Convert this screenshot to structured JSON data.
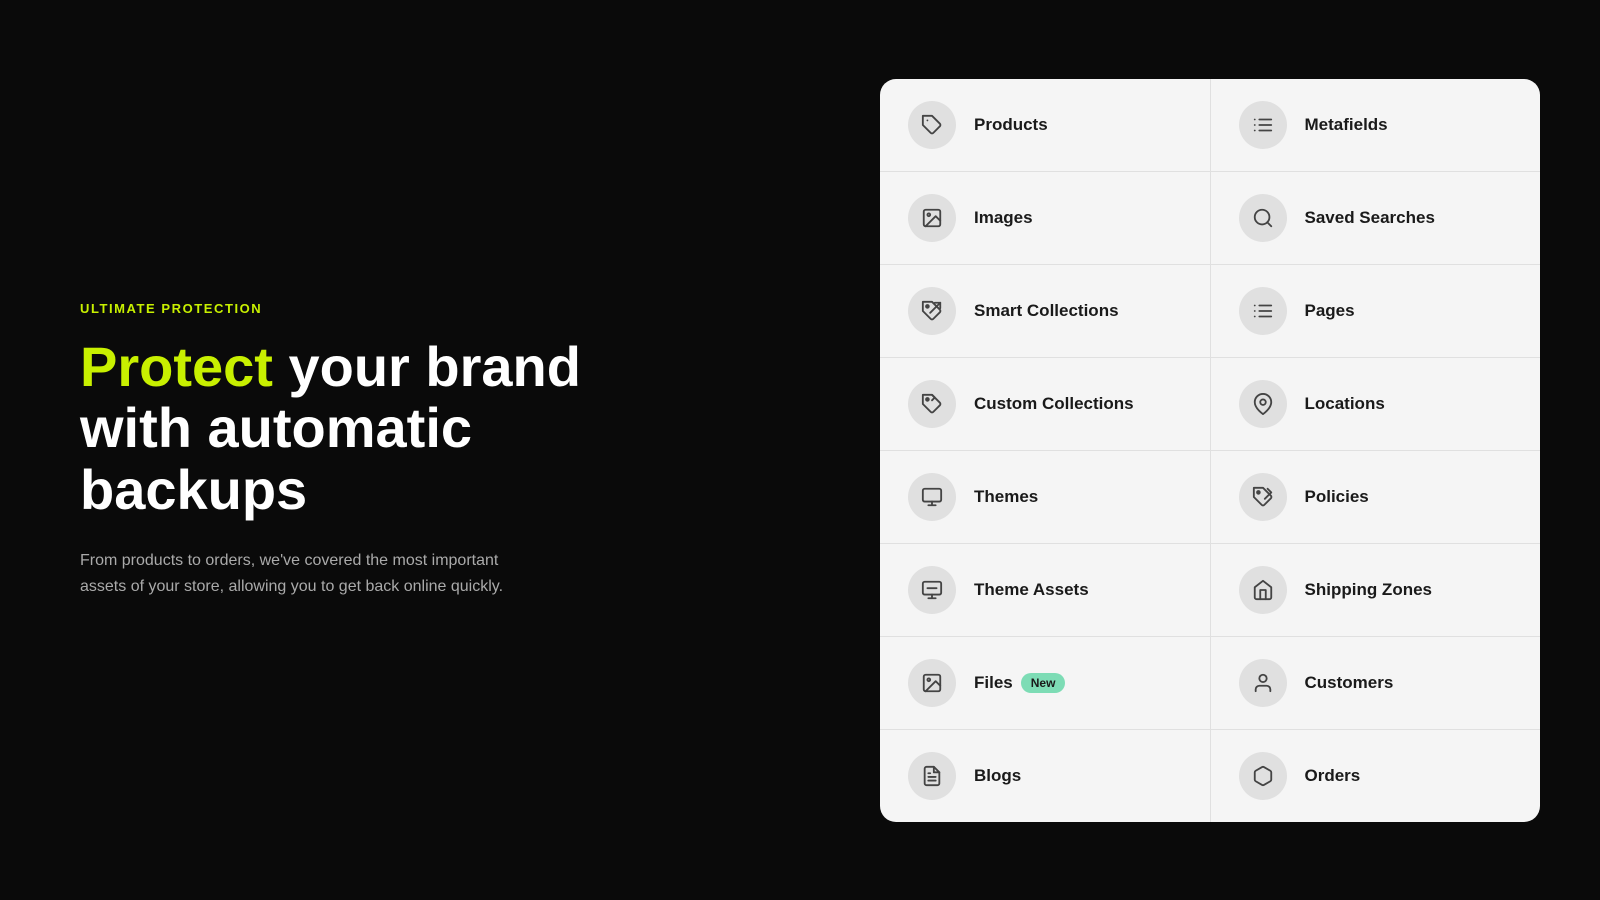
{
  "left": {
    "label": "ULTIMATE PROTECTION",
    "headline_part1": "Protect",
    "headline_part2": " your brand\nwith automatic backups",
    "description": "From products to orders, we've covered the most important assets of your store, allowing you to get back online quickly."
  },
  "grid": {
    "rows": [
      {
        "left": {
          "label": "Products",
          "icon": "🏷",
          "badge": null
        },
        "right": {
          "label": "Metafields",
          "icon": "☰",
          "badge": null
        }
      },
      {
        "left": {
          "label": "Images",
          "icon": "🖼",
          "badge": null
        },
        "right": {
          "label": "Saved Searches",
          "icon": "🔍",
          "badge": null
        }
      },
      {
        "left": {
          "label": "Smart Collections",
          "icon": "🔄",
          "badge": null
        },
        "right": {
          "label": "Pages",
          "icon": "☰",
          "badge": null
        }
      },
      {
        "left": {
          "label": "Custom Collections",
          "icon": "🔄",
          "badge": null
        },
        "right": {
          "label": "Locations",
          "icon": "📍",
          "badge": null
        }
      },
      {
        "left": {
          "label": "Themes",
          "icon": "🎨",
          "badge": null
        },
        "right": {
          "label": "Policies",
          "icon": "🔄",
          "badge": null
        }
      },
      {
        "left": {
          "label": "Theme Assets",
          "icon": "🎨",
          "badge": null
        },
        "right": {
          "label": "Shipping Zones",
          "icon": "🏠",
          "badge": null
        }
      },
      {
        "left": {
          "label": "Files",
          "icon": "🖼",
          "badge": "New"
        },
        "right": {
          "label": "Customers",
          "icon": "👤",
          "badge": null
        }
      },
      {
        "left": {
          "label": "Blogs",
          "icon": "📋",
          "badge": null
        },
        "right": {
          "label": "Orders",
          "icon": "📦",
          "badge": null
        }
      }
    ]
  },
  "icons": {
    "products": "tag",
    "images": "image",
    "smart_collections": "refresh",
    "custom_collections": "refresh",
    "themes": "palette",
    "theme_assets": "palette",
    "files": "image",
    "blogs": "list",
    "metafields": "list-detail",
    "saved_searches": "search",
    "pages": "list-detail",
    "locations": "pin",
    "policies": "shield",
    "shipping_zones": "house",
    "customers": "person",
    "orders": "box"
  }
}
